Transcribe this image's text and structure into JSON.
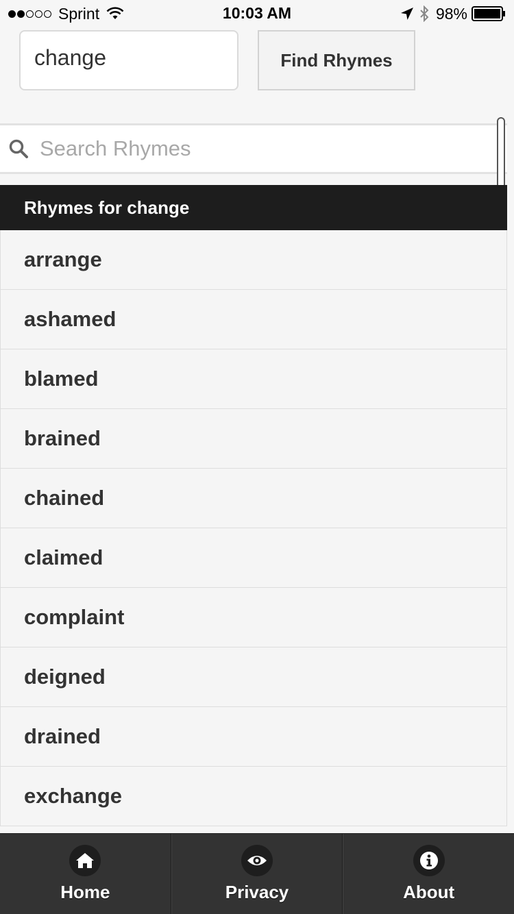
{
  "status_bar": {
    "carrier": "Sprint",
    "time": "10:03 AM",
    "battery": "98%",
    "signal_strength": 2,
    "signal_total": 5
  },
  "form": {
    "word_value": "change",
    "find_button_label": "Find Rhymes"
  },
  "filter": {
    "placeholder": "Search Rhymes"
  },
  "list": {
    "header": "Rhymes for change",
    "items": [
      {
        "label": "arrange"
      },
      {
        "label": "ashamed"
      },
      {
        "label": "blamed"
      },
      {
        "label": "brained"
      },
      {
        "label": "chained"
      },
      {
        "label": "claimed"
      },
      {
        "label": "complaint"
      },
      {
        "label": "deigned"
      },
      {
        "label": "drained"
      },
      {
        "label": "exchange"
      }
    ]
  },
  "tab_bar": {
    "tabs": [
      {
        "label": "Home",
        "icon": "home-icon"
      },
      {
        "label": "Privacy",
        "icon": "eye-icon"
      },
      {
        "label": "About",
        "icon": "info-icon"
      }
    ]
  }
}
